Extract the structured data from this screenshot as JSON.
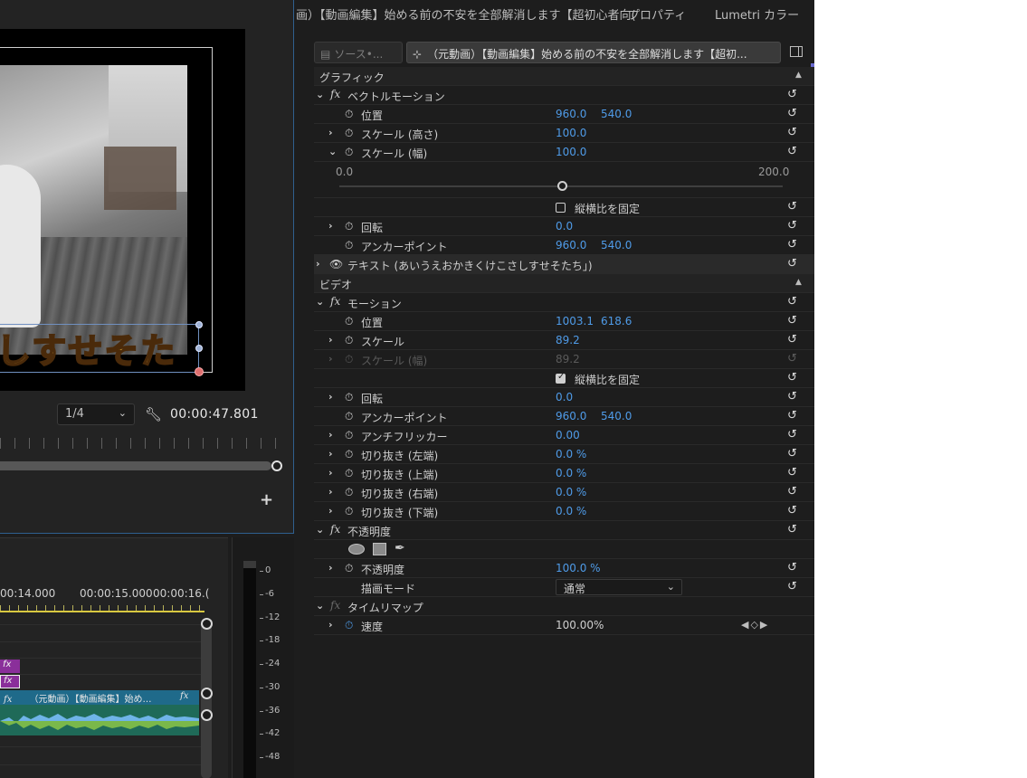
{
  "monitor": {
    "caption": "しすせそた",
    "zoom": "1/4",
    "timecode": "00:00:47.801"
  },
  "timeline": {
    "timecodes": [
      "00:14.000",
      "00:00:15.000",
      "00:00:16.("
    ],
    "fx_label": "fx",
    "clip_label": "（元動画）【動画編集】始め…"
  },
  "meter": {
    "db_labels": [
      "0",
      "-6",
      "-12",
      "-18",
      "-24",
      "-30",
      "-36",
      "-42",
      "-48"
    ]
  },
  "tabs": {
    "effect_controls": "画）【動画編集】始める前の不安を全部解消します【超初心者向(",
    "properties": "プロパティ",
    "lumetri": "Lumetri カラー"
  },
  "subbar": {
    "source_tab": "ソース•...",
    "clip_tab": "（元動画）【動画編集】始める前の不安を全部解消します【超初..."
  },
  "sections": {
    "graphic": "グラフィック",
    "video": "ビデオ"
  },
  "vector_motion": {
    "name": "ベクトルモーション",
    "position_label": "位置",
    "position_x": "960.0",
    "position_y": "540.0",
    "scale_h_label": "スケール (高さ)",
    "scale_h": "100.0",
    "scale_w_label": "スケール (幅)",
    "scale_w": "100.0",
    "slider_min": "0.0",
    "slider_max": "200.0",
    "lock_label": "縦横比を固定",
    "rotation_label": "回転",
    "rotation": "0.0",
    "anchor_label": "アンカーポイント",
    "anchor_x": "960.0",
    "anchor_y": "540.0"
  },
  "text_layer": "テキスト (あいうえおかきくけこさしすせそたち｣)",
  "motion": {
    "name": "モーション",
    "position_label": "位置",
    "position_x": "1003.1",
    "position_y": "618.6",
    "scale_label": "スケール",
    "scale": "89.2",
    "scale_w_label": "スケール (幅)",
    "scale_w": "89.2",
    "lock_label": "縦横比を固定",
    "rotation_label": "回転",
    "rotation": "0.0",
    "anchor_label": "アンカーポイント",
    "anchor_x": "960.0",
    "anchor_y": "540.0",
    "antiflicker_label": "アンチフリッカー",
    "antiflicker": "0.00",
    "crop_left_label": "切り抜き (左端)",
    "crop_left": "0.0 %",
    "crop_top_label": "切り抜き (上端)",
    "crop_top": "0.0 %",
    "crop_right_label": "切り抜き (右端)",
    "crop_right": "0.0 %",
    "crop_bottom_label": "切り抜き (下端)",
    "crop_bottom": "0.0 %"
  },
  "opacity": {
    "name": "不透明度",
    "opacity_label": "不透明度",
    "opacity": "100.0 %",
    "blend_label": "描画モード",
    "blend": "通常"
  },
  "time_remap": {
    "name": "タイムリマップ",
    "speed_label": "速度",
    "speed": "100.00%"
  },
  "colors": {
    "value_blue": "#4f9be8",
    "fx_clip": "#8a2f9a",
    "video_clip": "#1f6a8a",
    "audio_clip": "#1f6a58"
  }
}
